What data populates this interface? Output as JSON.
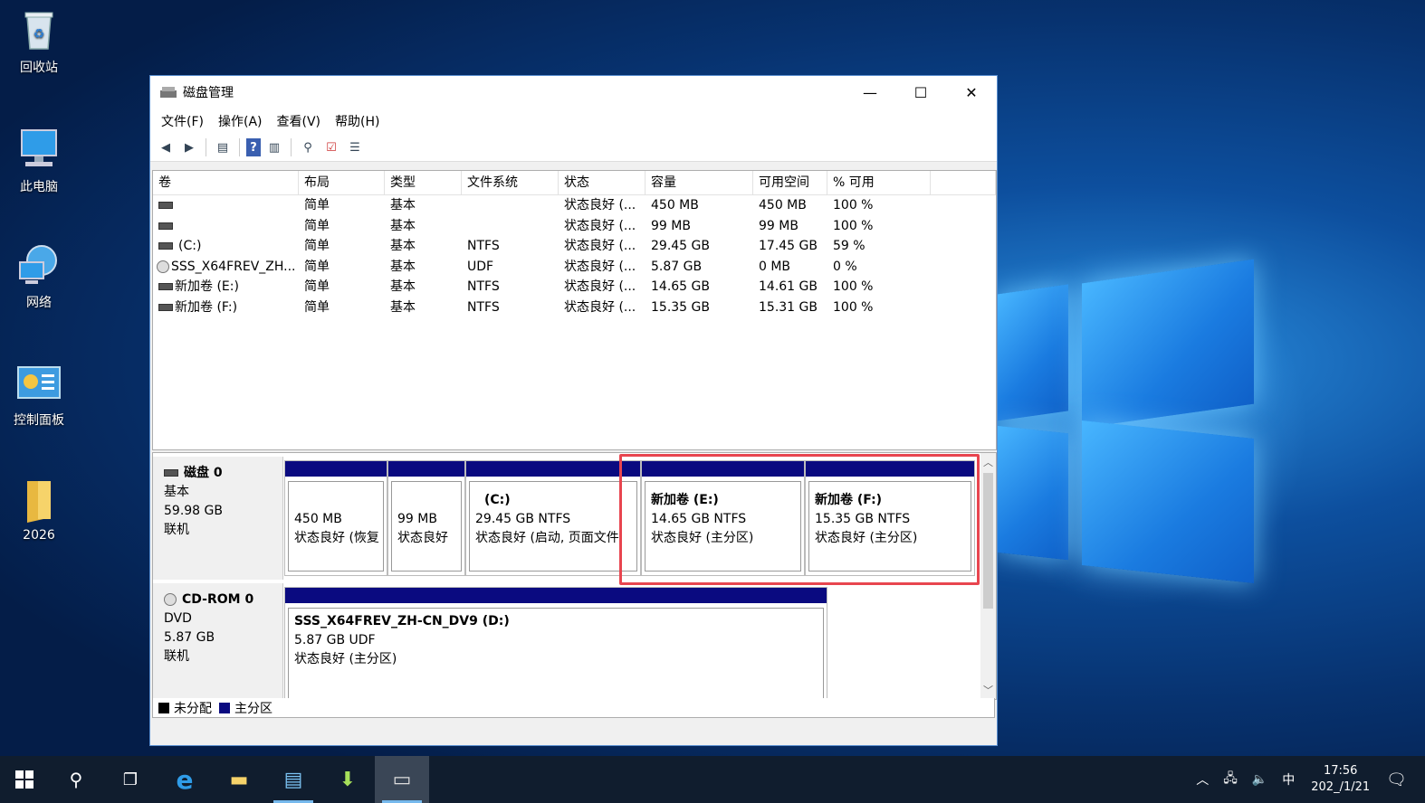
{
  "desktop": {
    "icons": [
      {
        "label": "回收站",
        "icon": "recycle-bin-icon"
      },
      {
        "label": "此电脑",
        "icon": "computer-icon"
      },
      {
        "label": "网络",
        "icon": "network-icon"
      },
      {
        "label": "控制面板",
        "icon": "control-panel-icon"
      },
      {
        "label": "2026",
        "icon": "folder-icon"
      }
    ]
  },
  "window": {
    "title": "磁盘管理",
    "controls": {
      "minimize": "—",
      "maximize": "☐",
      "close": "✕"
    },
    "menu": [
      "文件(F)",
      "操作(A)",
      "查看(V)",
      "帮助(H)"
    ],
    "toolbar": [
      "back-icon",
      "forward-icon",
      "properties-icon",
      "help-icon",
      "view-icon",
      "connect-icon",
      "check-icon",
      "list-icon"
    ],
    "list": {
      "columns": [
        "卷",
        "布局",
        "类型",
        "文件系统",
        "状态",
        "容量",
        "可用空间",
        "% 可用",
        ""
      ],
      "rows": [
        {
          "vol": "",
          "layout": "简单",
          "type": "基本",
          "fs": "",
          "status": "状态良好 (...",
          "cap": "450 MB",
          "free": "450 MB",
          "pct": "100 %",
          "icon": "drive"
        },
        {
          "vol": "",
          "layout": "简单",
          "type": "基本",
          "fs": "",
          "status": "状态良好 (...",
          "cap": "99 MB",
          "free": "99 MB",
          "pct": "100 %",
          "icon": "drive"
        },
        {
          "vol": "(C:)",
          "layout": "简单",
          "type": "基本",
          "fs": "NTFS",
          "status": "状态良好 (...",
          "cap": "29.45 GB",
          "free": "17.45 GB",
          "pct": "59 %",
          "icon": "drive"
        },
        {
          "vol": "SSS_X64FREV_ZH...",
          "layout": "简单",
          "type": "基本",
          "fs": "UDF",
          "status": "状态良好 (...",
          "cap": "5.87 GB",
          "free": "0 MB",
          "pct": "0 %",
          "icon": "cd"
        },
        {
          "vol": "新加卷 (E:)",
          "layout": "简单",
          "type": "基本",
          "fs": "NTFS",
          "status": "状态良好 (...",
          "cap": "14.65 GB",
          "free": "14.61 GB",
          "pct": "100 %",
          "icon": "drive"
        },
        {
          "vol": "新加卷 (F:)",
          "layout": "简单",
          "type": "基本",
          "fs": "NTFS",
          "status": "状态良好 (...",
          "cap": "15.35 GB",
          "free": "15.31 GB",
          "pct": "100 %",
          "icon": "drive"
        }
      ]
    },
    "disk0": {
      "name": "磁盘 0",
      "type": "基本",
      "size": "59.98 GB",
      "state": "联机",
      "partitions": [
        {
          "title": "",
          "size": "450 MB",
          "status": "状态良好 (恢复"
        },
        {
          "title": "",
          "size": "99 MB",
          "status": "状态良好"
        },
        {
          "title": "(C:)",
          "size": "29.45 GB NTFS",
          "status": "状态良好 (启动, 页面文件,"
        },
        {
          "title": "新加卷  (E:)",
          "size": "14.65 GB NTFS",
          "status": "状态良好 (主分区)"
        },
        {
          "title": "新加卷  (F:)",
          "size": "15.35 GB NTFS",
          "status": "状态良好 (主分区)"
        }
      ]
    },
    "cdrom0": {
      "name": "CD-ROM 0",
      "type": "DVD",
      "size": "5.87 GB",
      "state": "联机",
      "partition": {
        "title": "SSS_X64FREV_ZH-CN_DV9  (D:)",
        "size": "5.87 GB UDF",
        "status": "状态良好 (主分区)"
      }
    },
    "legend": [
      {
        "label": "未分配",
        "color": "#000000"
      },
      {
        "label": "主分区",
        "color": "#0a0a80"
      }
    ]
  },
  "taskbar": {
    "ime": "中",
    "clock_time": "17:56",
    "clock_date": "202_/1/21"
  },
  "colors": {
    "partition_bar": "#0a0a80",
    "highlight": "#e8454f",
    "taskbar": "#101d2e"
  }
}
